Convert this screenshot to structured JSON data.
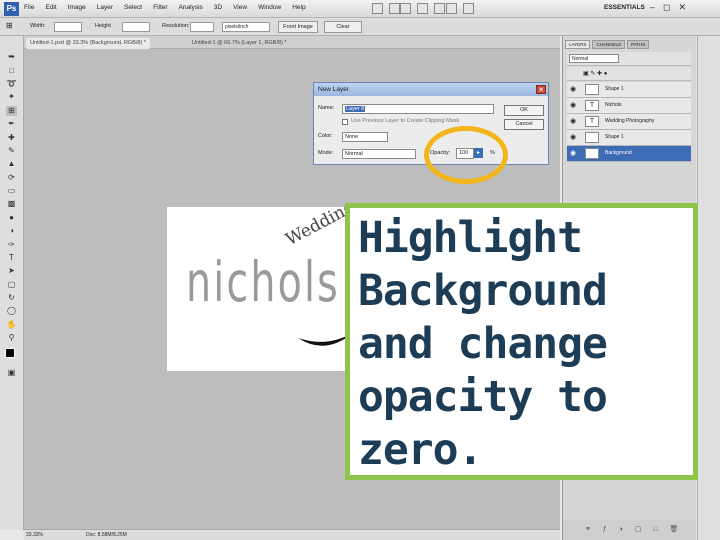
{
  "app": {
    "logo": "Ps",
    "workspace": "ESSENTIALS"
  },
  "menu": [
    "File",
    "Edit",
    "Image",
    "Layer",
    "Select",
    "Filter",
    "Analysis",
    "3D",
    "View",
    "Window",
    "Help"
  ],
  "options_bar": {
    "width_label": "Width:",
    "height_label": "Height",
    "resolution_label": "Resolution:",
    "resolution_unit": "pixels/inch",
    "front_image_button": "Front Image",
    "clear_button": "Clear"
  },
  "tabs": [
    "Untitled-1.psd @ 33.3% (Background, RGB/8) *",
    "Untitled-1 @ 66.7% (Layer 1, RGB/8) *"
  ],
  "status": {
    "zoom": "33.33%",
    "doc": "Doc: 8.58M/8.25M"
  },
  "document": {
    "main_word": "nichols",
    "arc_word": "Wedding"
  },
  "dialog": {
    "title": "New Layer",
    "name_label": "Name:",
    "name_value": "Layer 6",
    "checkbox_label": "Use Previous Layer to Create Clipping Mask",
    "color_label": "Color:",
    "color_value": "None",
    "mode_label": "Mode:",
    "mode_value": "Normal",
    "opacity_label": "Opacity:",
    "opacity_value": "100",
    "opacity_unit": "%",
    "ok": "OK",
    "cancel": "Cancel"
  },
  "panel": {
    "tabs": [
      "LAYERS",
      "CHANNELS",
      "PATHS"
    ],
    "blend_mode": "Normal",
    "layers": [
      {
        "name": "Shape 1",
        "thumb": "",
        "selected": false
      },
      {
        "name": "Nichols",
        "thumb": "T",
        "selected": false
      },
      {
        "name": "Wedding Photography",
        "thumb": "T",
        "selected": false
      },
      {
        "name": "Shape 1",
        "thumb": "",
        "selected": false
      },
      {
        "name": "Background",
        "thumb": "",
        "selected": true
      }
    ]
  },
  "annotation": {
    "lines": [
      "Highlight",
      "Background",
      "and change",
      "opacity to",
      "zero."
    ]
  },
  "colors": {
    "highlight_ring": "#f2b51a",
    "annotation_border": "#8ec44c",
    "annotation_text": "#1d3d56",
    "selection": "#3d6bb4"
  }
}
